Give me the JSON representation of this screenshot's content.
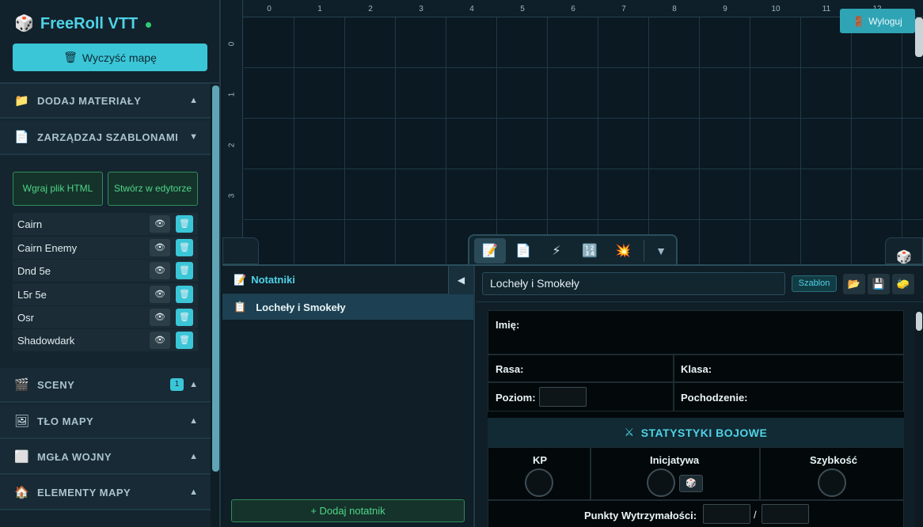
{
  "brand": {
    "title": "FreeRoll VTT",
    "icon": "dice-icon",
    "status_color": "#2ecc71"
  },
  "sidebar": {
    "clear_map_label": "Wyczyść mapę",
    "sections": {
      "add_materials": "DODAJ MATERIAŁY",
      "templates": "ZARZĄDZAJ SZABLONAMI",
      "scenes": "SCENY",
      "scenes_count": "1",
      "map_bg": "TŁO MAPY",
      "fog": "MGŁA WOJNY",
      "map_elements": "ELEMENTY MAPY"
    },
    "upload_html_label": "Wgraj plik HTML",
    "create_editor_label": "Stwórz w edytorze",
    "templates_list": [
      "Cairn",
      "Cairn Enemy",
      "Dnd 5e",
      "L5r 5e",
      "Osr",
      "Shadowdark"
    ]
  },
  "map": {
    "ruler_x": [
      "0",
      "1",
      "2",
      "3",
      "4",
      "5",
      "6",
      "7",
      "8",
      "9",
      "10",
      "11",
      "12"
    ],
    "ruler_y": [
      "0",
      "1",
      "2",
      "3"
    ],
    "logout_label": "Wyloguj"
  },
  "notes": {
    "header": "Notatniki",
    "items": [
      "Locheły i Smokeły"
    ],
    "add_label": "+ Dodaj notatnik"
  },
  "editor": {
    "title_value": "Locheły i Smokeły",
    "template_tag": "Szablon",
    "sheet": {
      "name_label": "Imię:",
      "race_label": "Rasa:",
      "class_label": "Klasa:",
      "level_label": "Poziom:",
      "origin_label": "Pochodzenie:",
      "combat_header": "STATYSTYKI BOJOWE",
      "ac_label": "KP",
      "initiative_label": "Inicjatywa",
      "speed_label": "Szybkość",
      "hp_label": "Punkty Wytrzymałości:",
      "hp_sep": "/"
    }
  },
  "colors": {
    "accent": "#3bc6d8",
    "green": "#4fd68a",
    "bg": "#0d1b24"
  }
}
